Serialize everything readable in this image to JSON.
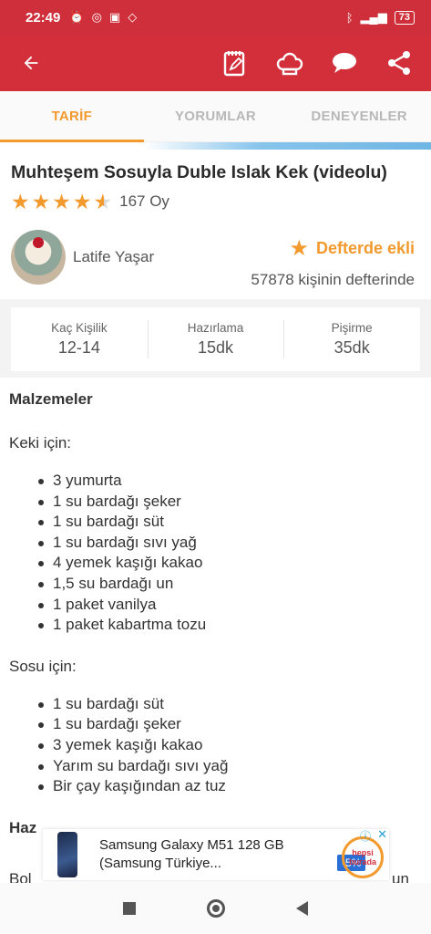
{
  "status_bar": {
    "time": "22:49",
    "battery": "73"
  },
  "tabs": [
    {
      "label": "TARİF",
      "active": true
    },
    {
      "label": "YORUMLAR",
      "active": false
    },
    {
      "label": "DENEYENLER",
      "active": false
    }
  ],
  "recipe": {
    "title": "Muhteşem Sosuyla Duble Islak Kek (videolu)",
    "rating": 4.5,
    "votes": "167 Oy",
    "author": "Latife Yaşar",
    "notebook_label": "Defterde ekli",
    "notebook_count": "57878 kişinin defterinde"
  },
  "info": [
    {
      "label": "Kaç Kişilik",
      "value": "12-14"
    },
    {
      "label": "Hazırlama",
      "value": "15dk"
    },
    {
      "label": "Pişirme",
      "value": "35dk"
    }
  ],
  "ingredients": {
    "heading": "Malzemeler",
    "groups": [
      {
        "title": "Keki için:",
        "items": [
          "3 yumurta",
          "1 su bardağı şeker",
          "1 su bardağı süt",
          "1 su bardağı sıvı yağ",
          "4 yemek kaşığı kakao",
          "1,5 su bardağı un",
          "1 paket vanilya",
          "1 paket kabartma tozu"
        ]
      },
      {
        "title": "Sosu için:",
        "items": [
          "1 su bardağı süt",
          "1 su bardağı şeker",
          "3 yemek kaşığı kakao",
          "Yarım su bardağı sıvı yağ",
          "Bir çay kaşığından az tuz"
        ]
      }
    ],
    "next_heading_fragment": "Haz",
    "next_line_fragment_left": "Bol",
    "next_line_fragment_right": "un"
  },
  "ad": {
    "text": "Samsung Galaxy M51 128 GB (Samsung Türkiye...",
    "discount": "-5%",
    "brand": "hepsi burada"
  },
  "colors": {
    "primary": "#d32f3b",
    "accent": "#f29a2e"
  }
}
